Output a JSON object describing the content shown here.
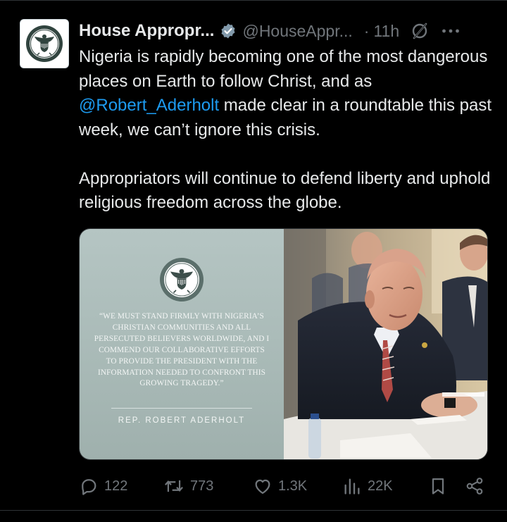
{
  "author": {
    "name": "House Appropr...",
    "handle": "@HouseAppr...",
    "separator": "·",
    "time": "11h",
    "avatar_icon": "house-appropriations-seal",
    "verified_icon": "verified-badge-gray"
  },
  "tweet": {
    "line1_before": "Nigeria is rapidly becoming one of the most dangerous places on Earth to follow Christ, and as ",
    "mention": "@Robert_Aderholt",
    "line1_after": " made clear in a roundtable this past week, we can’t ignore this crisis.",
    "paragraph2": "Appropriators will continue to defend liberty and uphold religious freedom across the globe."
  },
  "media": {
    "quote": "“WE MUST STAND FIRMLY WITH NIGERIA’S CHRISTIAN COMMUNITIES AND ALL PERSECUTED BELIEVERS WORLDWIDE, AND I COMMEND OUR COLLABORATIVE EFFORTS TO PROVIDE THE PRESIDENT WITH THE INFORMATION NEEDED TO CONFRONT THIS GROWING TRAGEDY.”",
    "attribution": "REP. ROBERT ADERHOLT",
    "photo_subject": "photo-of-rep-aderholt-at-roundtable"
  },
  "actions": {
    "replies": "122",
    "reposts": "773",
    "likes": "1.3K",
    "views": "22K"
  },
  "colors": {
    "background": "#000000",
    "text": "#e7e9ea",
    "secondary": "#71767b",
    "link": "#1d9bf0",
    "quote_panel": "#aebfbc"
  }
}
